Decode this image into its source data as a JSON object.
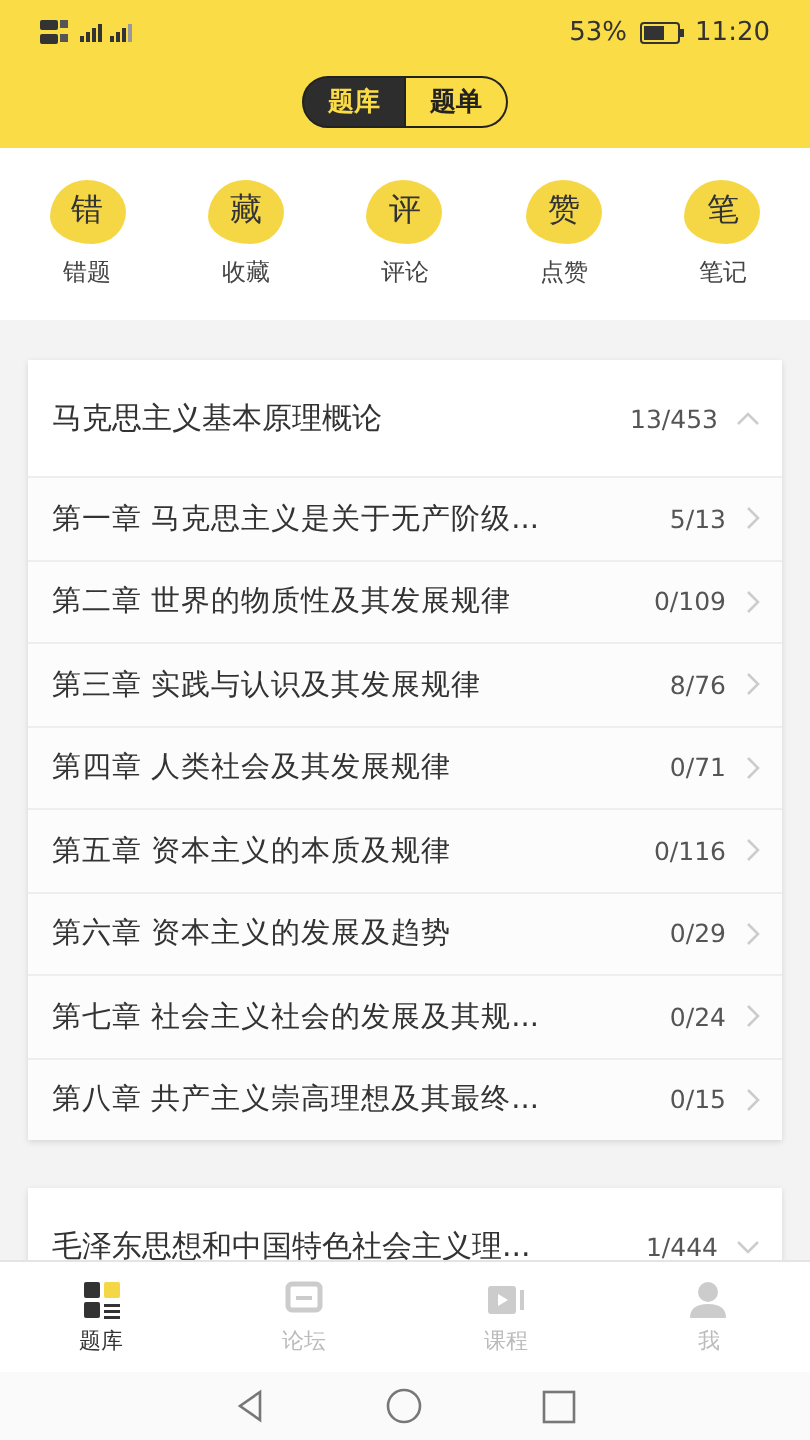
{
  "status_bar": {
    "battery": "53%",
    "time": "11:20"
  },
  "segments": [
    {
      "label": "题库",
      "selected": true
    },
    {
      "label": "题单",
      "selected": false
    }
  ],
  "shortcuts": [
    {
      "icon": "错",
      "label": "错题"
    },
    {
      "icon": "藏",
      "label": "收藏"
    },
    {
      "icon": "评",
      "label": "评论"
    },
    {
      "icon": "赞",
      "label": "点赞"
    },
    {
      "icon": "笔",
      "label": "笔记"
    }
  ],
  "subjects": [
    {
      "title": "马克思主义基本原理概论",
      "count": "13/453",
      "expanded": true,
      "chapters": [
        {
          "title": "第一章 马克思主义是关于无产阶级...",
          "count": "5/13"
        },
        {
          "title": "第二章 世界的物质性及其发展规律",
          "count": "0/109"
        },
        {
          "title": "第三章 实践与认识及其发展规律",
          "count": "8/76"
        },
        {
          "title": "第四章 人类社会及其发展规律",
          "count": "0/71"
        },
        {
          "title": "第五章 资本主义的本质及规律",
          "count": "0/116"
        },
        {
          "title": "第六章 资本主义的发展及趋势",
          "count": "0/29"
        },
        {
          "title": "第七章 社会主义社会的发展及其规...",
          "count": "0/24"
        },
        {
          "title": "第八章 共产主义崇高理想及其最终...",
          "count": "0/15"
        }
      ]
    },
    {
      "title": "毛泽东思想和中国特色社会主义理...",
      "count": "1/444",
      "expanded": false
    }
  ],
  "bottom_nav": [
    {
      "label": "题库",
      "selected": true
    },
    {
      "label": "论坛",
      "selected": false
    },
    {
      "label": "课程",
      "selected": false
    },
    {
      "label": "我",
      "selected": false
    }
  ]
}
